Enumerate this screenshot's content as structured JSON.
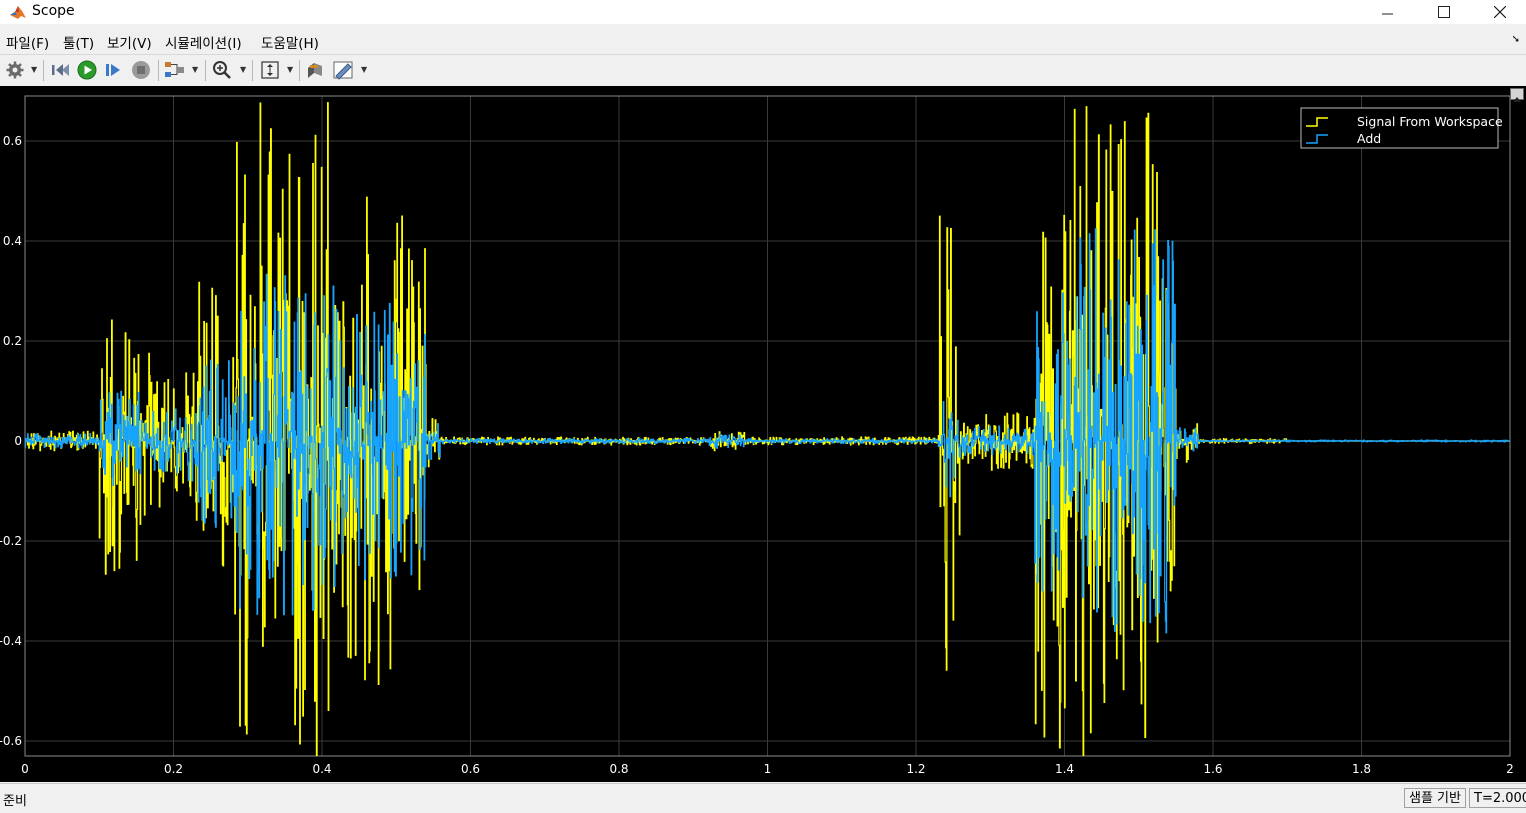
{
  "window": {
    "title": "Scope",
    "icon": "matlab-logo-icon"
  },
  "window_controls": [
    "minimize-icon",
    "maximize-icon",
    "close-icon"
  ],
  "menu": [
    {
      "label": "파일(F)"
    },
    {
      "label": "툴(T)"
    },
    {
      "label": "보기(V)"
    },
    {
      "label": "시뮬레이션(I)"
    },
    {
      "label": "도움말(H)"
    }
  ],
  "toolbar": {
    "icons": [
      "gear-icon",
      "step-back-icon",
      "run-icon",
      "step-forward-icon",
      "stop-icon",
      "signal-config-icon",
      "zoom-in-icon",
      "autoscale-icon",
      "highlight-icon",
      "triggers-icon"
    ]
  },
  "status": {
    "text": "준비",
    "sample_mode": "샘플 기반",
    "time": "T=2.000"
  },
  "colors": {
    "series1": "#ffff00",
    "series2": "#16a4ff",
    "background": "#000000",
    "grid": "#3a3a3a"
  },
  "chart_data": {
    "type": "line",
    "title": "",
    "xlabel": "",
    "ylabel": "",
    "xlim": [
      0,
      2
    ],
    "ylim": [
      -0.63,
      0.69
    ],
    "xticks": [
      "0",
      "0.2",
      "0.4",
      "0.6",
      "0.8",
      "1",
      "1.2",
      "1.4",
      "1.6",
      "1.8",
      "2"
    ],
    "yticks": [
      "-0.6",
      "-0.4",
      "-0.2",
      "0",
      "0.2",
      "0.4",
      "0.6"
    ],
    "grid": true,
    "legend": "top-right",
    "series": [
      {
        "name": "Signal From Workspace",
        "color": "#ffff00",
        "style": "stairs",
        "segments": [
          {
            "t0": 0.0,
            "t1": 0.1,
            "amp": 0.02
          },
          {
            "t0": 0.1,
            "t1": 0.17,
            "amp": 0.27
          },
          {
            "t0": 0.17,
            "t1": 0.23,
            "amp": 0.14
          },
          {
            "t0": 0.23,
            "t1": 0.28,
            "amp": 0.35
          },
          {
            "t0": 0.28,
            "t1": 0.42,
            "amp": 0.69
          },
          {
            "t0": 0.42,
            "t1": 0.54,
            "amp": 0.5
          },
          {
            "t0": 0.54,
            "t1": 0.56,
            "amp": 0.06
          },
          {
            "t0": 0.56,
            "t1": 0.92,
            "amp": 0.008
          },
          {
            "t0": 0.92,
            "t1": 0.97,
            "amp": 0.02
          },
          {
            "t0": 0.97,
            "t1": 1.23,
            "amp": 0.008
          },
          {
            "t0": 1.23,
            "t1": 1.26,
            "amp": 0.48
          },
          {
            "t0": 1.26,
            "t1": 1.36,
            "amp": 0.06
          },
          {
            "t0": 1.36,
            "t1": 1.42,
            "amp": 0.69
          },
          {
            "t0": 1.42,
            "t1": 1.55,
            "amp": 0.69
          },
          {
            "t0": 1.55,
            "t1": 1.58,
            "amp": 0.05
          },
          {
            "t0": 1.58,
            "t1": 1.7,
            "amp": 0.005
          }
        ]
      },
      {
        "name": "Add",
        "color": "#16a4ff",
        "style": "stairs",
        "segments": [
          {
            "t0": 0.0,
            "t1": 0.1,
            "amp": 0.015
          },
          {
            "t0": 0.1,
            "t1": 0.17,
            "amp": 0.1
          },
          {
            "t0": 0.17,
            "t1": 0.23,
            "amp": 0.08
          },
          {
            "t0": 0.23,
            "t1": 0.28,
            "amp": 0.2
          },
          {
            "t0": 0.28,
            "t1": 0.42,
            "amp": 0.35
          },
          {
            "t0": 0.42,
            "t1": 0.54,
            "amp": 0.28
          },
          {
            "t0": 0.54,
            "t1": 0.56,
            "amp": 0.04
          },
          {
            "t0": 0.56,
            "t1": 0.92,
            "amp": 0.005
          },
          {
            "t0": 0.92,
            "t1": 0.97,
            "amp": 0.015
          },
          {
            "t0": 0.97,
            "t1": 1.23,
            "amp": 0.005
          },
          {
            "t0": 1.23,
            "t1": 1.26,
            "amp": 0.12
          },
          {
            "t0": 1.26,
            "t1": 1.36,
            "amp": 0.03
          },
          {
            "t0": 1.36,
            "t1": 1.42,
            "amp": 0.3
          },
          {
            "t0": 1.42,
            "t1": 1.55,
            "amp": 0.43
          },
          {
            "t0": 1.55,
            "t1": 1.58,
            "amp": 0.03
          },
          {
            "t0": 1.58,
            "t1": 2.0,
            "amp": 0.002
          }
        ]
      }
    ]
  }
}
